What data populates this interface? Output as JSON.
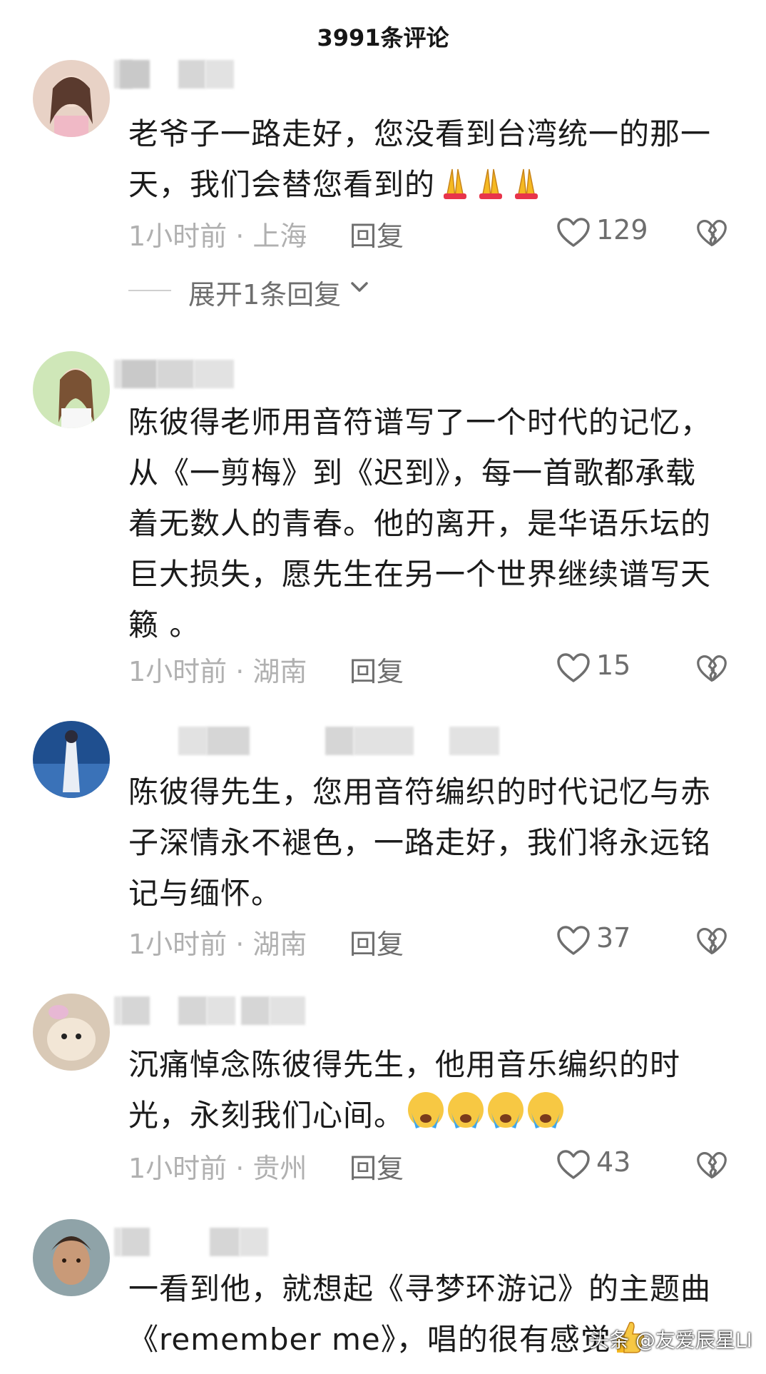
{
  "header": {
    "title": "3991条评论"
  },
  "comments": [
    {
      "text": "老爷子一路走好，您没看到台湾统一的那一天，我们会替您看到的",
      "emoji_count": 3,
      "time_location": "1小时前 · 上海",
      "reply_label": "回复",
      "likes": "129",
      "expand_label": "展开1条回复"
    },
    {
      "text": "陈彼得老师用音符谱写了一个时代的记忆，从《一剪梅》到《迟到》，每一首歌都承载着无数人的青春。他的离开，是华语乐坛的巨大损失，愿先生在另一个世界继续谱写天籁 。",
      "time_location": "1小时前 · 湖南",
      "reply_label": "回复",
      "likes": "15"
    },
    {
      "text": "陈彼得先生，您用音符编织的时代记忆与赤子深情永不褪色，一路走好，我们将永远铭记与缅怀。",
      "time_location": "1小时前 · 湖南",
      "reply_label": "回复",
      "likes": "37"
    },
    {
      "text": "沉痛悼念陈彼得先生，他用音乐编织的时光，永刻我们心间。",
      "emoji_count": 4,
      "time_location": "1小时前 · 贵州",
      "reply_label": "回复",
      "likes": "43"
    },
    {
      "text": "一看到他，就想起《寻梦环游记》的主题曲《remember me》，唱的很有感觉"
    }
  ],
  "watermark": "头条 @友爱辰星LI",
  "icons": {
    "like": "heart-outline-icon",
    "dislike": "broken-heart-icon",
    "expand": "chevron-down-icon",
    "pray": "folded-hands-emoji",
    "cry": "loudly-crying-emoji"
  },
  "colors": {
    "meta_gray": "#b0b0b0",
    "action_gray": "#6e6e6e",
    "text": "#1b1b1b"
  }
}
